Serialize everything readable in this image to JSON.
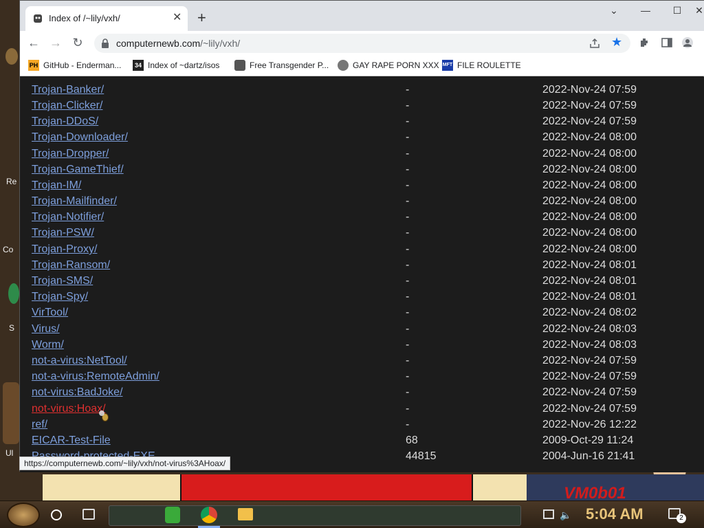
{
  "tab": {
    "title": "Index of /~lily/vxh/"
  },
  "address": {
    "host": "computernewb.com",
    "path": "/~lily/vxh/"
  },
  "bookmarks": [
    {
      "label": "GitHub - Enderman...",
      "icon": "PH"
    },
    {
      "label": "Index of ~dartz/isos",
      "icon": "34"
    },
    {
      "label": "Free Transgender P...",
      "icon": "globe"
    },
    {
      "label": "GAY RAPE PORN XXX",
      "icon": "globe"
    },
    {
      "label": "FILE ROULETTE",
      "icon": "MFT"
    }
  ],
  "listing": [
    {
      "name": "Trojan-Banker/",
      "size": "-",
      "date": "2022-Nov-24 07:59"
    },
    {
      "name": "Trojan-Clicker/",
      "size": "-",
      "date": "2022-Nov-24 07:59"
    },
    {
      "name": "Trojan-DDoS/",
      "size": "-",
      "date": "2022-Nov-24 07:59"
    },
    {
      "name": "Trojan-Downloader/",
      "size": "-",
      "date": "2022-Nov-24 08:00"
    },
    {
      "name": "Trojan-Dropper/",
      "size": "-",
      "date": "2022-Nov-24 08:00"
    },
    {
      "name": "Trojan-GameThief/",
      "size": "-",
      "date": "2022-Nov-24 08:00"
    },
    {
      "name": "Trojan-IM/",
      "size": "-",
      "date": "2022-Nov-24 08:00"
    },
    {
      "name": "Trojan-Mailfinder/",
      "size": "-",
      "date": "2022-Nov-24 08:00"
    },
    {
      "name": "Trojan-Notifier/",
      "size": "-",
      "date": "2022-Nov-24 08:00"
    },
    {
      "name": "Trojan-PSW/",
      "size": "-",
      "date": "2022-Nov-24 08:00"
    },
    {
      "name": "Trojan-Proxy/",
      "size": "-",
      "date": "2022-Nov-24 08:00"
    },
    {
      "name": "Trojan-Ransom/",
      "size": "-",
      "date": "2022-Nov-24 08:01"
    },
    {
      "name": "Trojan-SMS/",
      "size": "-",
      "date": "2022-Nov-24 08:01"
    },
    {
      "name": "Trojan-Spy/",
      "size": "-",
      "date": "2022-Nov-24 08:01"
    },
    {
      "name": "VirTool/",
      "size": "-",
      "date": "2022-Nov-24 08:02"
    },
    {
      "name": "Virus/",
      "size": "-",
      "date": "2022-Nov-24 08:03"
    },
    {
      "name": "Worm/",
      "size": "-",
      "date": "2022-Nov-24 08:03"
    },
    {
      "name": "not-a-virus:NetTool/",
      "size": "-",
      "date": "2022-Nov-24 07:59"
    },
    {
      "name": "not-a-virus:RemoteAdmin/",
      "size": "-",
      "date": "2022-Nov-24 07:59"
    },
    {
      "name": "not-virus:BadJoke/",
      "size": "-",
      "date": "2022-Nov-24 07:59"
    },
    {
      "name": "not-virus:Hoax/",
      "size": "-",
      "date": "2022-Nov-24 07:59"
    },
    {
      "name": "ref/",
      "size": "-",
      "date": "2022-Nov-26 12:22"
    },
    {
      "name": "EICAR-Test-File",
      "size": "68",
      "date": "2009-Oct-29 11:24"
    },
    {
      "name": "Password-protected-EXE",
      "size": "44815",
      "date": "2004-Jun-16 21:41"
    }
  ],
  "hovered_row": "not-virus:Hoax/",
  "status_url": "https://computernewb.com/~lily/vxh/not-virus%3AHoax/",
  "desktop": {
    "frag1": "Re",
    "frag2": "Co",
    "frag3": "S",
    "frag4": "Ul",
    "banner": "VM0b01"
  },
  "taskbar": {
    "clock": "5:04 AM",
    "notifications": "2"
  },
  "colors": {
    "link": "#7d9fdc",
    "hover_link": "#e03030",
    "bg": "#1c1c1c",
    "clock": "#e8c47a"
  }
}
